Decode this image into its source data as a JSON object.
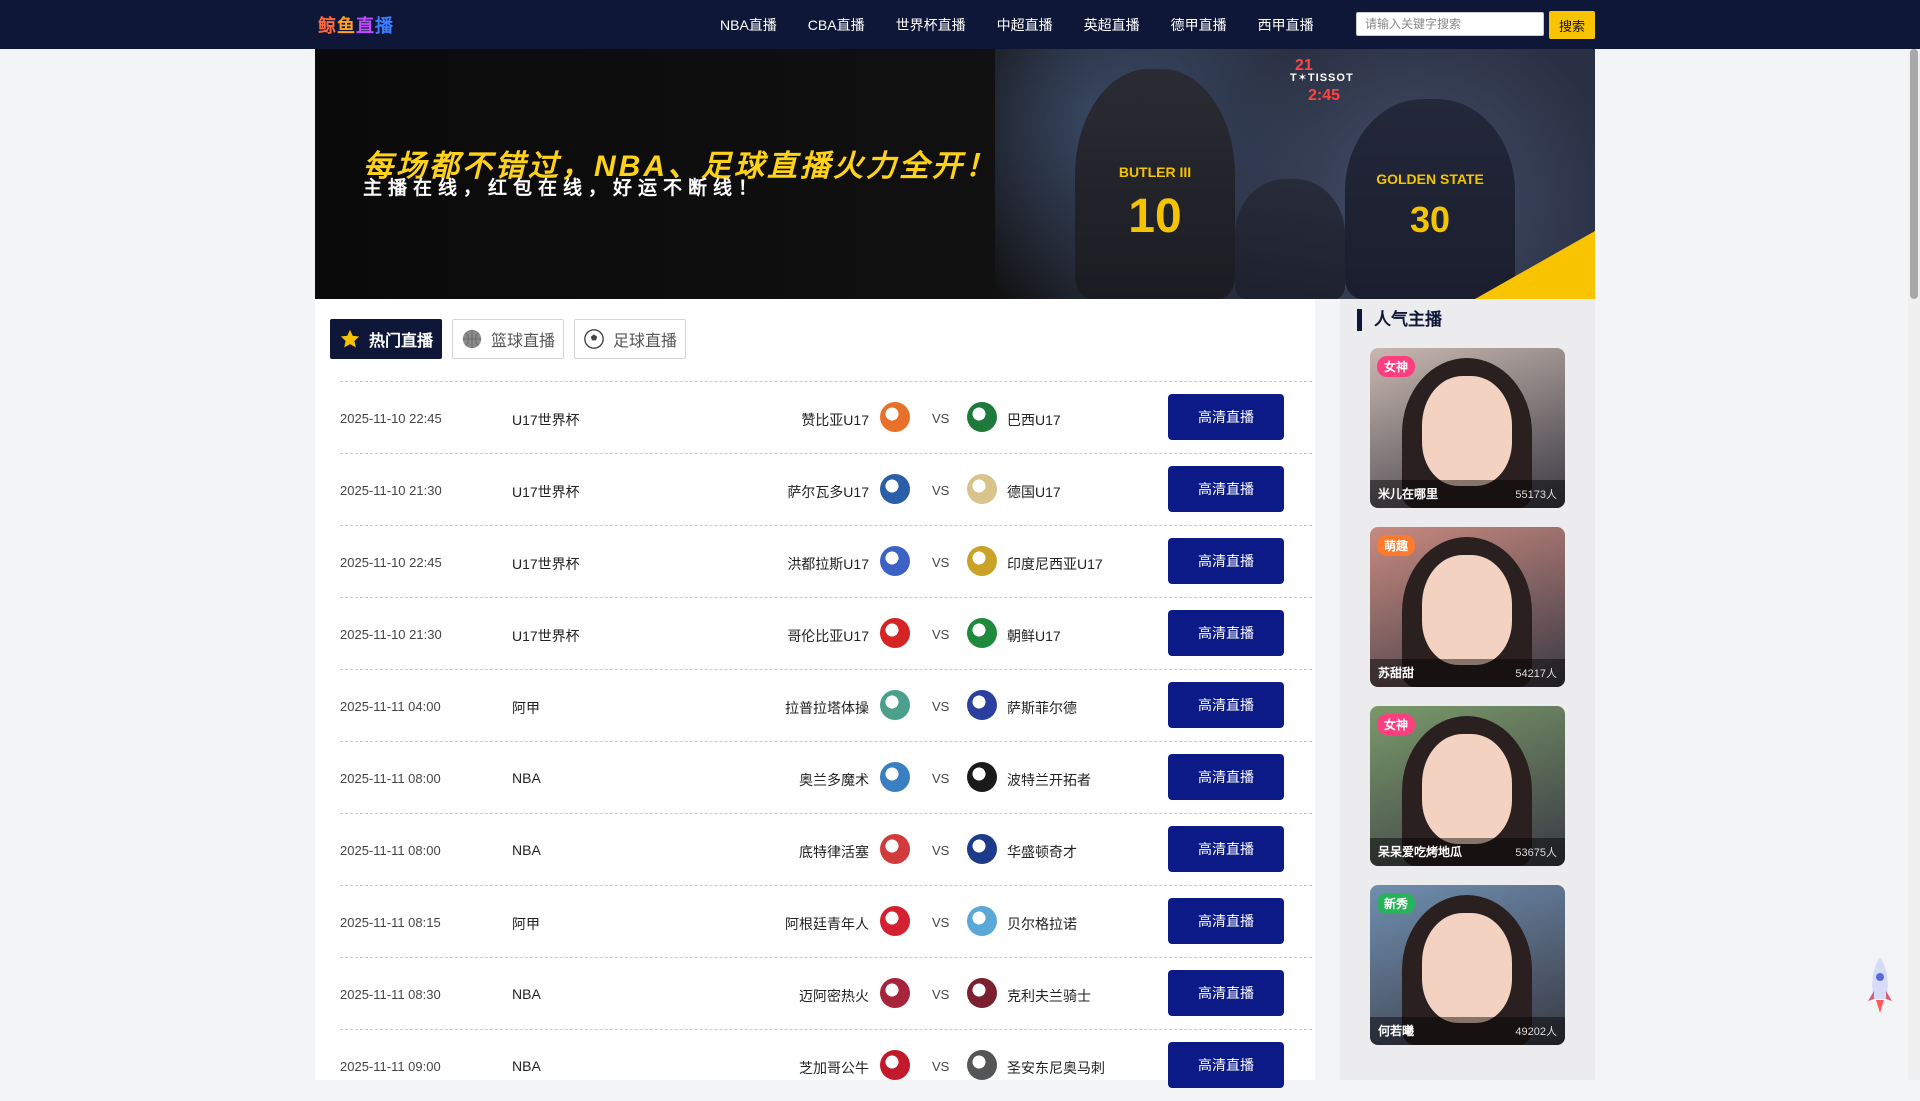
{
  "navbar": {
    "logo_chars": [
      "鲸",
      "鱼",
      "直",
      "播"
    ],
    "links": [
      "NBA直播",
      "CBA直播",
      "世界杯直播",
      "中超直播",
      "英超直播",
      "德甲直播",
      "西甲直播"
    ],
    "search_placeholder": "请输入关键字搜索",
    "search_button": "搜索"
  },
  "banner": {
    "headline": "每场都不错过，NBA、足球直播火力全开！",
    "subline": "主播在线，红包在线，好运不断线！",
    "scoreboard": "21",
    "tissot": "T✶TISSOT",
    "shot_clock": "2:45",
    "jersey_a_name": "BUTLER III",
    "jersey_a_number": "10",
    "jersey_b_name": "GOLDEN STATE",
    "jersey_b_number": "30"
  },
  "tabs": [
    {
      "label": "热门直播",
      "icon": "star-icon",
      "active": true
    },
    {
      "label": "篮球直播",
      "icon": "basketball-icon",
      "active": false
    },
    {
      "label": "足球直播",
      "icon": "soccer-ball-icon",
      "active": false
    }
  ],
  "matches": [
    {
      "time": "2025-11-10 22:45",
      "league": "U17世界杯",
      "home": "赞比亚U17",
      "vs": "VS",
      "away": "巴西U17",
      "button": "高清直播",
      "home_color": "#e8712a",
      "away_color": "#1d7a3a"
    },
    {
      "time": "2025-11-10 21:30",
      "league": "U17世界杯",
      "home": "萨尔瓦多U17",
      "vs": "VS",
      "away": "德国U17",
      "button": "高清直播",
      "home_color": "#2a5ea8",
      "away_color": "#d8c38a"
    },
    {
      "time": "2025-11-10 22:45",
      "league": "U17世界杯",
      "home": "洪都拉斯U17",
      "vs": "VS",
      "away": "印度尼西亚U17",
      "button": "高清直播",
      "home_color": "#3b62c4",
      "away_color": "#c9a227"
    },
    {
      "time": "2025-11-10 21:30",
      "league": "U17世界杯",
      "home": "哥伦比亚U17",
      "vs": "VS",
      "away": "朝鲜U17",
      "button": "高清直播",
      "home_color": "#d62424",
      "away_color": "#1f8a3e"
    },
    {
      "time": "2025-11-11 04:00",
      "league": "阿甲",
      "home": "拉普拉塔体操",
      "vs": "VS",
      "away": "萨斯菲尔德",
      "button": "高清直播",
      "home_color": "#4aa08a",
      "away_color": "#2b3f9e"
    },
    {
      "time": "2025-11-11 08:00",
      "league": "NBA",
      "home": "奥兰多魔术",
      "vs": "VS",
      "away": "波特兰开拓者",
      "button": "高清直播",
      "home_color": "#3a7fc2",
      "away_color": "#1a1a1a"
    },
    {
      "time": "2025-11-11 08:00",
      "league": "NBA",
      "home": "底特律活塞",
      "vs": "VS",
      "away": "华盛顿奇才",
      "button": "高清直播",
      "home_color": "#d23b3b",
      "away_color": "#1d3b8a"
    },
    {
      "time": "2025-11-11 08:15",
      "league": "阿甲",
      "home": "阿根廷青年人",
      "vs": "VS",
      "away": "贝尔格拉诺",
      "button": "高清直播",
      "home_color": "#d42030",
      "away_color": "#5aa8d8"
    },
    {
      "time": "2025-11-11 08:30",
      "league": "NBA",
      "home": "迈阿密热火",
      "vs": "VS",
      "away": "克利夫兰骑士",
      "button": "高清直播",
      "home_color": "#a8243a",
      "away_color": "#7a2030"
    },
    {
      "time": "2025-11-11 09:00",
      "league": "NBA",
      "home": "芝加哥公牛",
      "vs": "VS",
      "away": "圣安东尼奥马刺",
      "button": "高清直播",
      "home_color": "#c21a2a",
      "away_color": "#555555"
    }
  ],
  "sidebar": {
    "title": "人气主播",
    "anchors": [
      {
        "badge": "女神",
        "badge_color": "#ff3d7f",
        "name": "米儿在哪里",
        "viewers": "55173人",
        "bg": "#c9b8b0"
      },
      {
        "badge": "萌趣",
        "badge_color": "#ff7a2a",
        "name": "苏甜甜",
        "viewers": "54217人",
        "bg": "#c98a80"
      },
      {
        "badge": "女神",
        "badge_color": "#ff3d7f",
        "name": "呆呆爱吃烤地瓜",
        "viewers": "53675人",
        "bg": "#7a9a6a"
      },
      {
        "badge": "新秀",
        "badge_color": "#27b35a",
        "name": "何若曦",
        "viewers": "49202人",
        "bg": "#6f8fb0"
      }
    ]
  }
}
